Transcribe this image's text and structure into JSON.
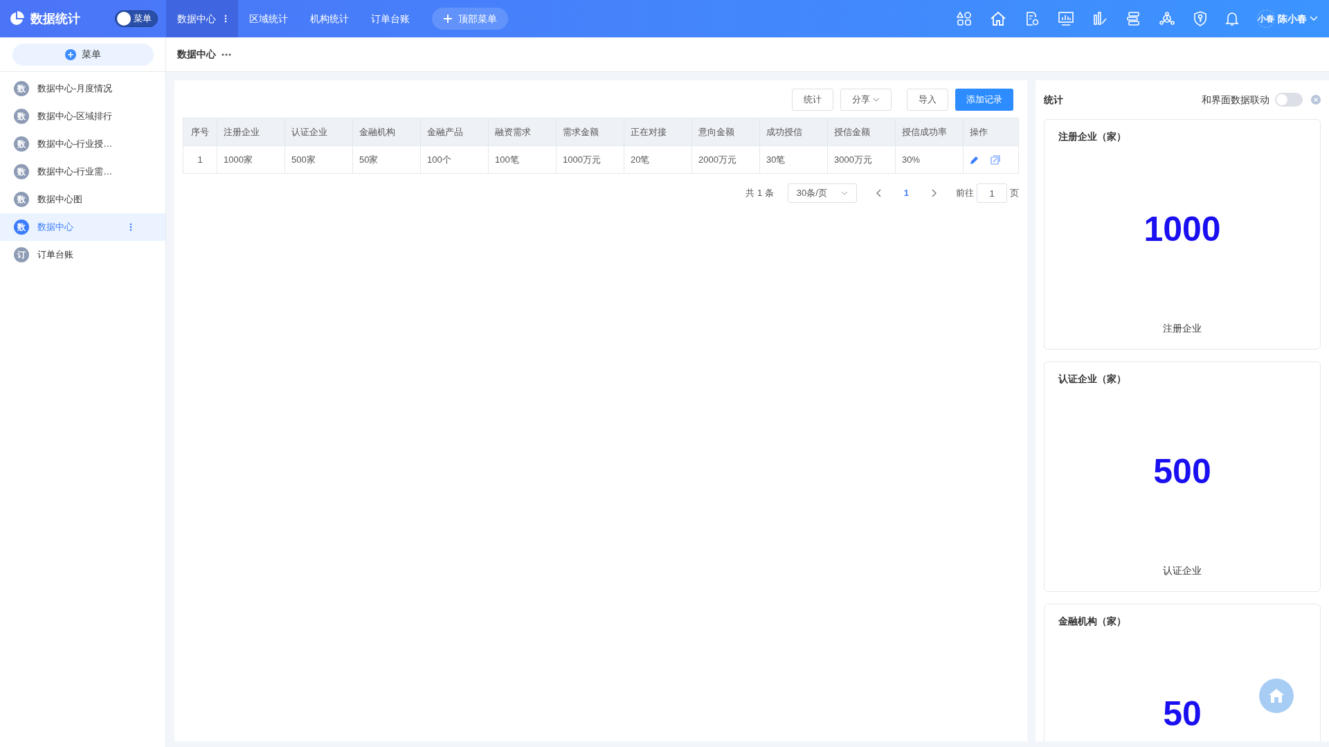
{
  "topbar": {
    "logo": "数据统计",
    "menu_switch": "菜单",
    "menu_switch_on": false,
    "tabs": [
      {
        "label": "数据中心",
        "selected": true
      },
      {
        "label": "区域统计",
        "selected": false
      },
      {
        "label": "机构统计",
        "selected": false
      },
      {
        "label": "订单台账",
        "selected": false
      }
    ],
    "add_menu": "顶部菜单",
    "user": {
      "avatar": "小春",
      "name": "陈小春"
    }
  },
  "sidebar": {
    "add_button": "菜单",
    "items": [
      {
        "badge": "数",
        "label": "数据中心-月度情况",
        "selected": false
      },
      {
        "badge": "数",
        "label": "数据中心-区域排行",
        "selected": false
      },
      {
        "badge": "数",
        "label": "数据中心-行业授…",
        "selected": false
      },
      {
        "badge": "数",
        "label": "数据中心-行业需…",
        "selected": false
      },
      {
        "badge": "数",
        "label": "数据中心图",
        "selected": false
      },
      {
        "badge": "数",
        "label": "数据中心",
        "selected": true
      },
      {
        "badge": "订",
        "label": "订单台账",
        "selected": false
      }
    ]
  },
  "breadcrumb": "数据中心",
  "toolbar": [
    "统计",
    "分享",
    "导入",
    "添加记录"
  ],
  "table": {
    "columns": [
      "序号",
      "注册企业",
      "认证企业",
      "金融机构",
      "金融产品",
      "融资需求",
      "需求金额",
      "正在对接",
      "意向金额",
      "成功授信",
      "授信金额",
      "授信成功率",
      "操作"
    ],
    "rows": [
      [
        "1",
        "1000家",
        "500家",
        "50家",
        "100个",
        "100笔",
        "1000万元",
        "20笔",
        "2000万元",
        "30笔",
        "3000万元",
        "30%"
      ]
    ]
  },
  "pagination": {
    "total": "共 1 条",
    "page_size": "30条/页",
    "current": "1",
    "goto_label": "前往",
    "goto_value": "1",
    "goto_suffix": "页"
  },
  "stats_panel": {
    "title": "统计",
    "link_label": "和界面数据联动",
    "link_on": false,
    "cards": [
      {
        "title": "注册企业（家）",
        "value": "1000",
        "label": "注册企业"
      },
      {
        "title": "认证企业（家）",
        "value": "500",
        "label": "认证企业"
      },
      {
        "title": "金融机构（家）",
        "value": "50"
      }
    ]
  }
}
